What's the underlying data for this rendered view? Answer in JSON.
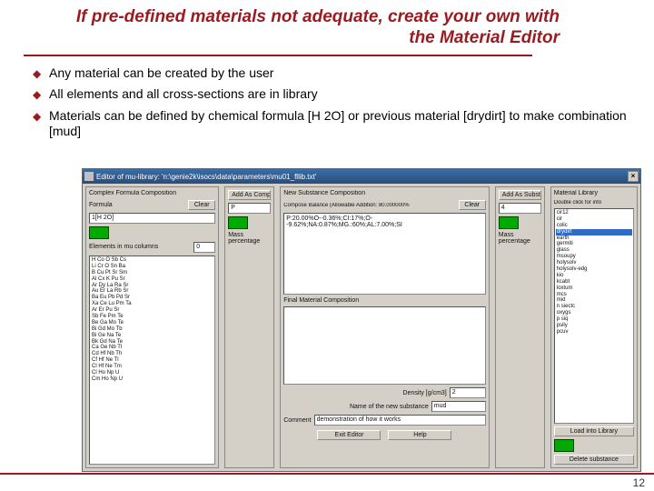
{
  "slide": {
    "title": "If pre-defined materials not adequate, create your own with the Material Editor",
    "bullets": [
      "Any material can be created by the user",
      "All elements and all cross-sections are in library",
      "Materials can be defined by chemical formula [H 2O] or previous material [drydirt] to make combination [mud]"
    ],
    "pagenum": "12"
  },
  "dialog": {
    "titlebar": "Editor of mu-library: 'n:\\genie2k\\isocs\\data\\parameters\\mu01_fllib.txt'",
    "close": "×",
    "panel_formula": {
      "header": "Complex Formula Composition",
      "formula_label": "Formula",
      "formula_value": "1[H 2O]",
      "clear_btn": "Clear",
      "elem_header": "Elements in mu columns",
      "step_value": "0",
      "element_rows": [
        "H  Co  O  Sb  Cs",
        "Li  Cr  O  Sn  Ba",
        "B  Cu  Pt  Sr  Sm",
        "Al  Cx  K  Pu  Sr",
        "Ar  Dy  La  Ra  Sr",
        "Au  Er  La  Rb  Sr",
        "Ba  Eu  Pb  Pd  Sr",
        "Xa  Ce  Lu  Pm  Ta",
        "Ar  Er  Pu  Sr",
        "Sb  Fe  Pm  Te",
        "Be  Ga  Mo  Te",
        "Bi  Gd  Mo  Tb",
        "Bi  Ge  Na  Te",
        "Bk  Gd  Na  Te",
        "Ca  Ge  Nb  Tl",
        "Cd  Hf  Nb  Th",
        "Cf  Hf  Ne  Tl",
        "Cl  Hf  Ne  Tm",
        "Cl  Ho  Np  U",
        "Cm  Ho  Np  U"
      ]
    },
    "panel_addcomp": {
      "add_btn": "Add As Compound",
      "comp_value": "P",
      "mass_label": "Mass percentage"
    },
    "panel_new": {
      "header": "New Substance Composition",
      "balance": "Compose Balance (Allowable Addition:   80.000000%",
      "clear_btn": "Clear",
      "param_text": "P:20.00%O--0.36%;CI:17%;O--9.62%;NA:0.87%;MG.:60%;AL:7.00%;SI",
      "final_label": "Final Material Composition",
      "density_label": "Density [g/cm3]",
      "density_value": "2",
      "name_label": "Name of the new substance",
      "name_value": "mud",
      "comment_label": "Comment",
      "comment_value": "demonstration of how it works"
    },
    "panel_addsub": {
      "add_btn": "Add As Substance",
      "sub_value": "4",
      "mass_label": "Mass percentage"
    },
    "panel_lib": {
      "header": "Material Library",
      "hint": "Double click for info",
      "items": [
        "cir12",
        "cir",
        "colic",
        "drydirt",
        "earth",
        "germiti",
        "glass",
        "msoupy",
        "holysolv",
        "holysolv-edg",
        "kio",
        "kcabt",
        "loxtum",
        "mcs",
        "mid",
        "n siectc",
        "oxygs",
        "p siq",
        "psily",
        "pcuv"
      ],
      "selected_index": 3,
      "load_btn": "Load into Library",
      "delete_btn": "Delete substance"
    },
    "footer": {
      "exit": "Exit Editor",
      "help": "Help"
    }
  }
}
